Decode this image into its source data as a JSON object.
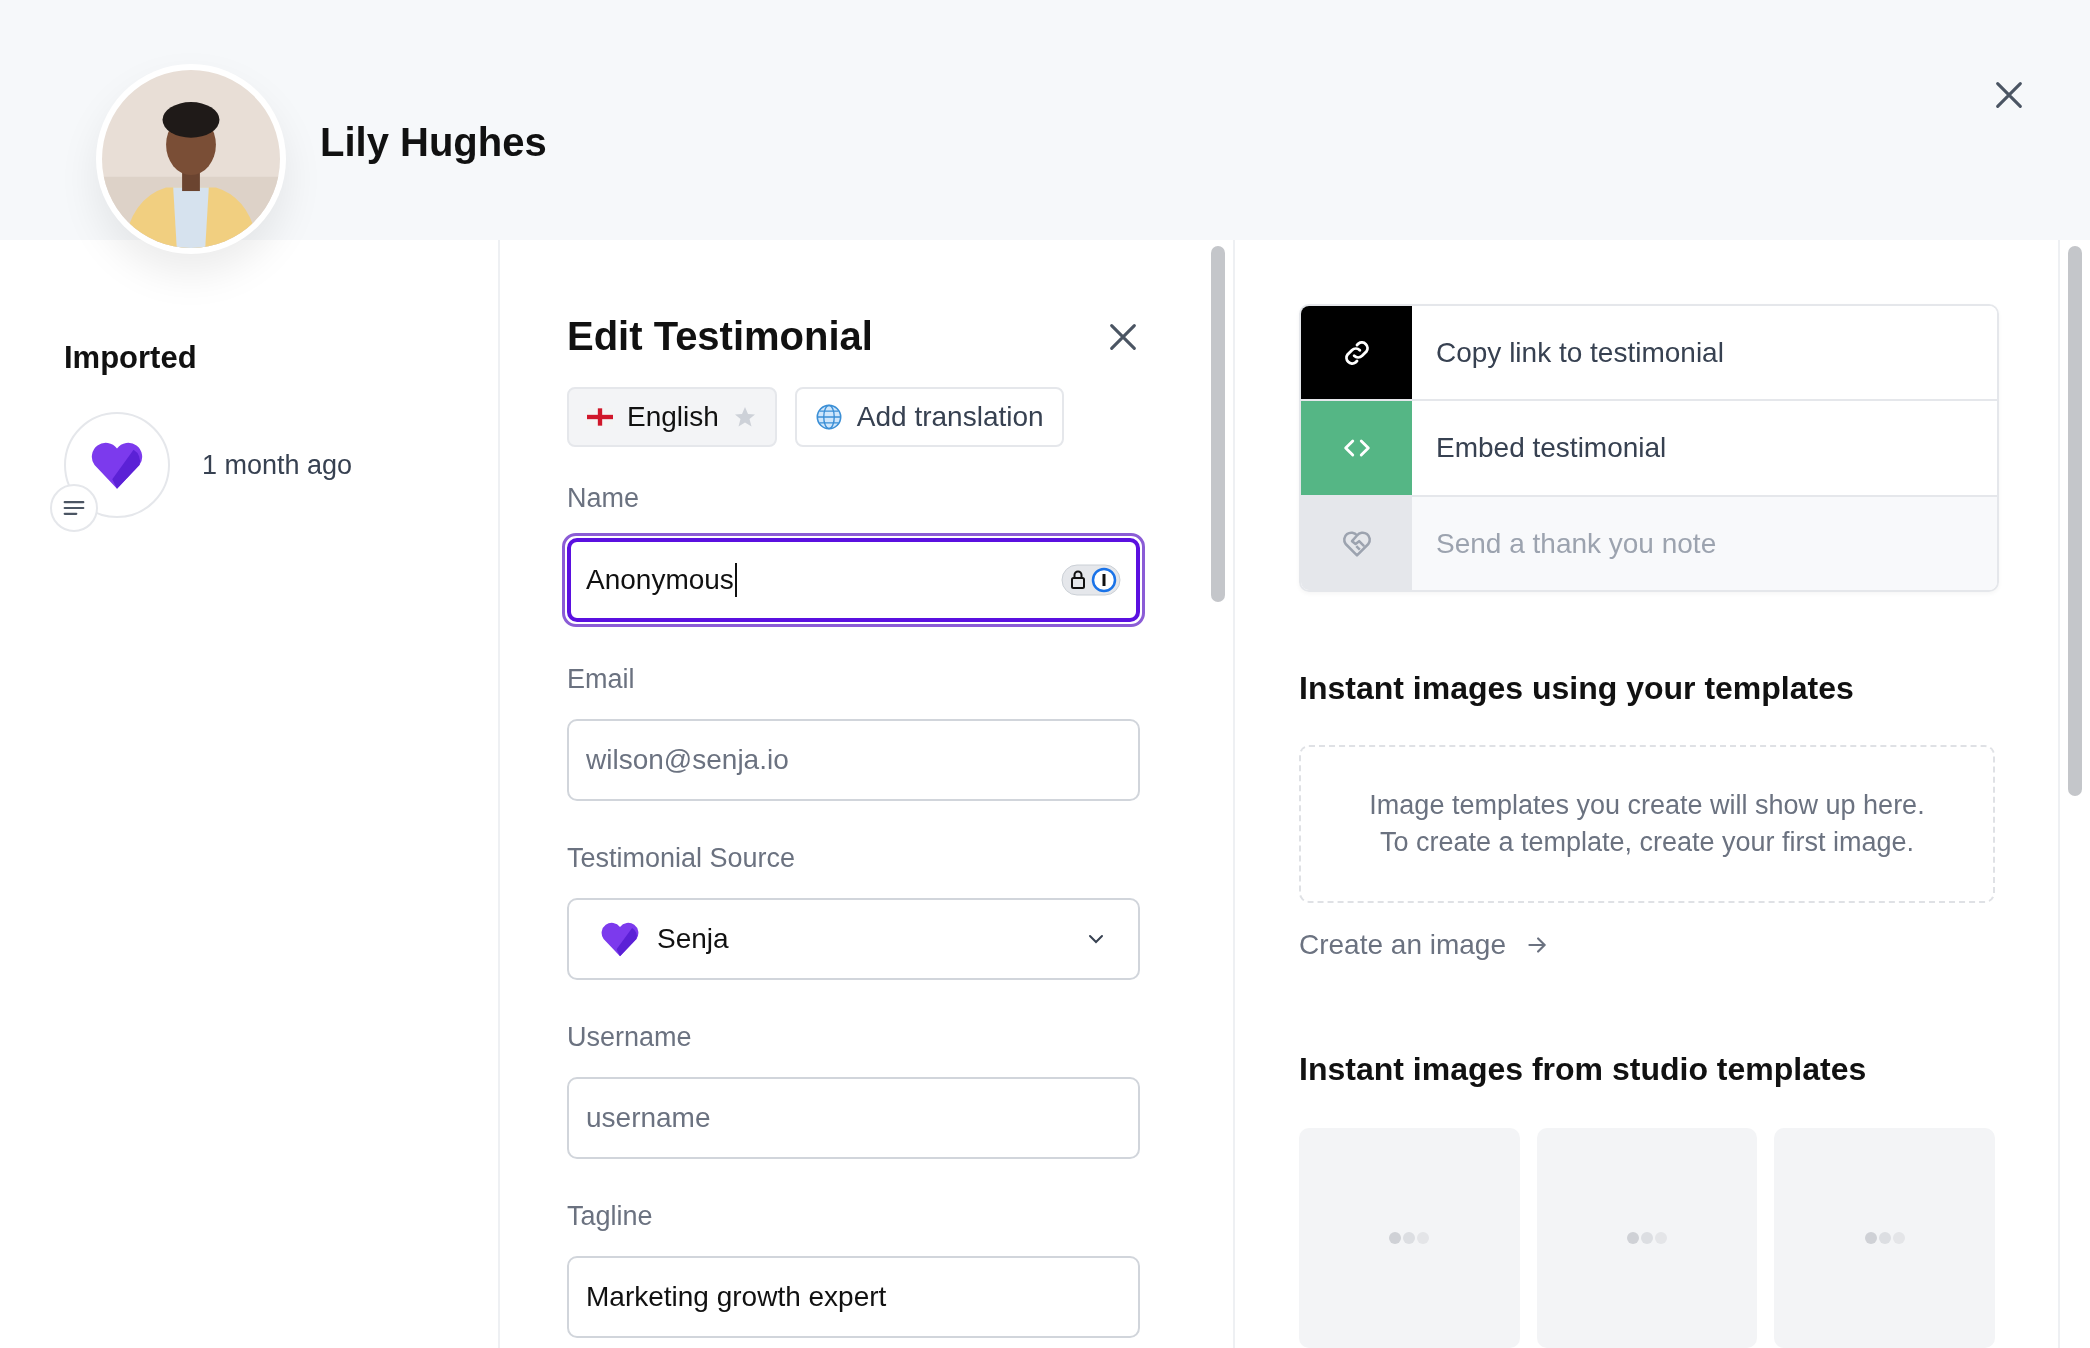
{
  "header": {
    "name": "Lily Hughes"
  },
  "sidebar": {
    "title": "Imported",
    "source": {
      "time": "1 month ago",
      "has_note": true
    }
  },
  "editor": {
    "title": "Edit Testimonial",
    "languages": [
      {
        "label": "English",
        "selected": true,
        "starred": false
      }
    ],
    "add_translation": "Add translation",
    "fields": [
      {
        "kind": "text",
        "label": "Name",
        "value": "Anonymous",
        "focused": true,
        "password_manager": true
      },
      {
        "kind": "text",
        "label": "Email",
        "placeholder": "wilson@senja.io",
        "focused": false,
        "password_manager": false
      },
      {
        "kind": "select",
        "label": "Testimonial Source",
        "value": "Senja",
        "focused": false,
        "password_manager": false
      },
      {
        "kind": "text",
        "label": "Username",
        "placeholder": "username",
        "focused": false,
        "password_manager": false
      },
      {
        "kind": "text",
        "label": "Tagline",
        "value": "Marketing growth expert",
        "focused": false,
        "password_manager": false
      }
    ]
  },
  "actions": [
    {
      "kind": "link",
      "label": "Copy link to testimonial",
      "disabled": false
    },
    {
      "kind": "embed",
      "label": "Embed testimonial",
      "disabled": false
    },
    {
      "kind": "thanks",
      "label": "Send a thank you note",
      "disabled": true
    }
  ],
  "your_templates": {
    "title": "Instant images using your templates",
    "empty_lines": [
      "Image templates you create will show up here.",
      "To create a template, create your first image."
    ],
    "link": "Create an image"
  },
  "studio_templates": {
    "title": "Instant images from studio templates",
    "cards": [
      {
        "kind": "loading"
      },
      {
        "kind": "loading"
      },
      {
        "kind": "loading"
      }
    ]
  }
}
